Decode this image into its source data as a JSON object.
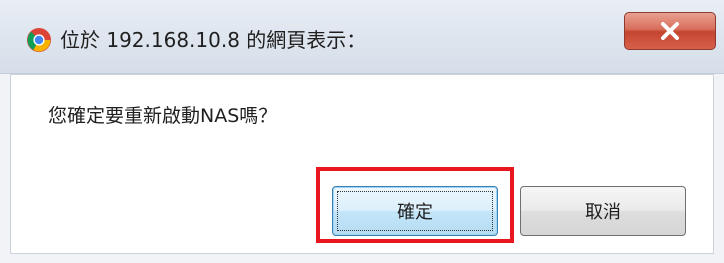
{
  "dialog": {
    "title": "位於 192.168.10.8 的網頁表示：",
    "message": "您確定要重新啟動NAS嗎？",
    "close_icon": "close-x",
    "logo_icon": "chrome-logo"
  },
  "buttons": {
    "ok_label": "確定",
    "cancel_label": "取消"
  },
  "colors": {
    "highlight": "#e8161e",
    "close_button": "#c4452f",
    "focus_button_border": "#3c7fb1"
  }
}
